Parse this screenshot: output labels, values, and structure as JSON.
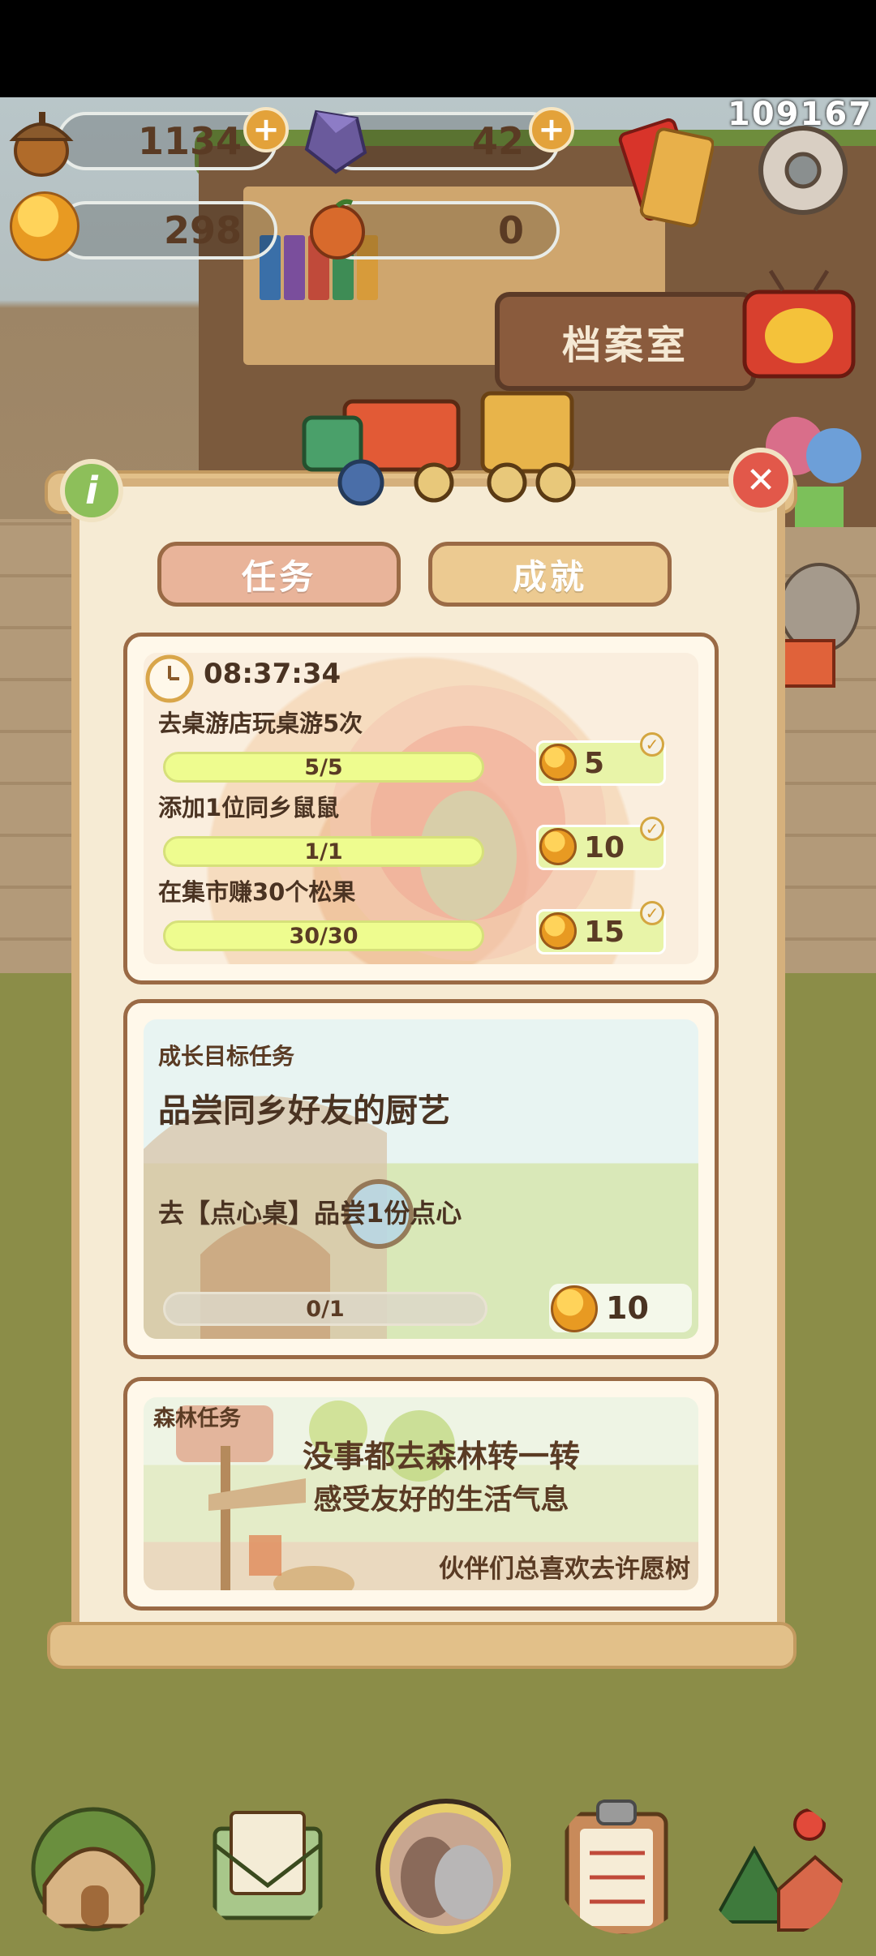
{
  "hud": {
    "acorns": "1134",
    "gems": "42",
    "bells": "298",
    "fruit": "0",
    "counter": "109167"
  },
  "shop_sign": "档案室",
  "tabs": {
    "tasks": "任务",
    "achievements": "成就"
  },
  "daily": {
    "timer": "08:37:34",
    "tasks": [
      {
        "label": "去桌游店玩桌游5次",
        "progress": "5/5",
        "reward": "5",
        "done": true
      },
      {
        "label": "添加1位同乡鼠鼠",
        "progress": "1/1",
        "reward": "10",
        "done": true
      },
      {
        "label": "在集市赚30个松果",
        "progress": "30/30",
        "reward": "15",
        "done": true
      }
    ]
  },
  "growth": {
    "header": "成长目标任务",
    "title": "品尝同乡好友的厨艺",
    "desc": "去【点心桌】品尝1份点心",
    "progress": "0/1",
    "progress_fraction": 0,
    "reward": "10"
  },
  "forest": {
    "header": "森林任务",
    "line1": "没事都去森林转一转",
    "line2": "感受友好的生活气息",
    "hint": "伙伴们总喜欢去许愿树"
  },
  "icons": {
    "info": "i",
    "close": "✕",
    "plus": "+",
    "check": "✓"
  },
  "colors": {
    "tab_active": "#e9b49a",
    "tab_inactive": "#ecca91",
    "bar_fill": "#eefc8f",
    "reward_bg": "#e8f4a8"
  }
}
